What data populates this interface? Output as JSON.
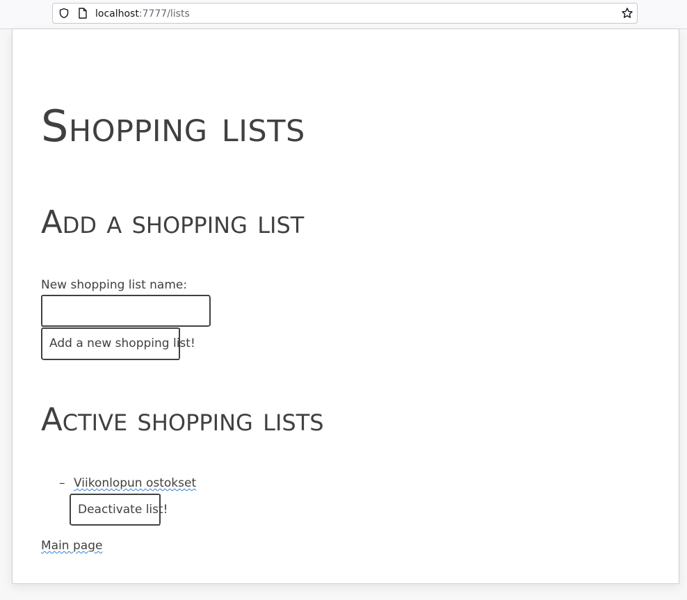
{
  "browser": {
    "url_host": "localhost",
    "url_path": ":7777/lists"
  },
  "page": {
    "title": "Shopping lists",
    "add_section": {
      "heading": "Add a shopping list",
      "input_label": "New shopping list name:",
      "input_value": "",
      "submit_label": "Add a new shopping list!"
    },
    "active_section": {
      "heading": "Active shopping lists",
      "lists": [
        {
          "name": "Viikonlopun ostokset",
          "action_label": "Deactivate list!"
        }
      ]
    },
    "main_link": "Main page"
  },
  "colors": {
    "ink": "#41403e",
    "link_underline": "#2f7fd4",
    "card_bg": "#ffffff"
  }
}
